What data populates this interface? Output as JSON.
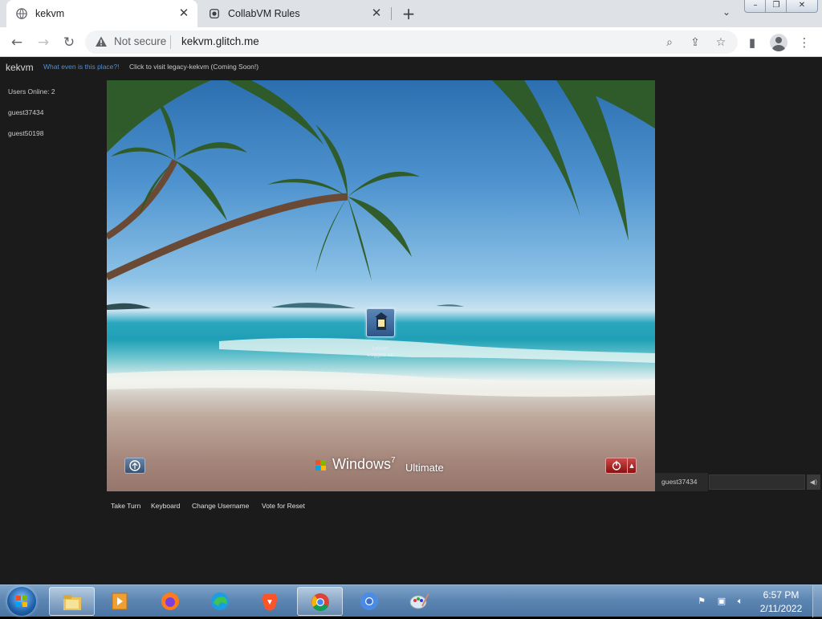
{
  "browser": {
    "tabs": [
      {
        "title": "kekvm",
        "active": true
      },
      {
        "title": "CollabVM Rules",
        "active": false
      }
    ],
    "security_label": "Not secure",
    "url": "kekvm.glitch.me"
  },
  "site": {
    "brand": "kekvm",
    "what_link": "What even is this place?!",
    "legacy_link": "Click to visit legacy-kekvm (Coming Soon!)",
    "users_online": "Users Online: 2",
    "users": [
      "guest37434",
      "guest50198"
    ]
  },
  "vm": {
    "logon_label_1": "kekvm",
    "logon_label_2": "Logged on",
    "windows_word": "Windows",
    "windows_version": "7",
    "windows_edition": "Ultimate"
  },
  "chat": {
    "username": "guest37434",
    "input_value": "",
    "send_icon": "speaker-icon"
  },
  "actions": {
    "take_turn": "Take Turn",
    "keyboard": "Keyboard",
    "change_username": "Change Username",
    "vote_reset": "Vote for Reset"
  },
  "taskbar": {
    "time": "6:57 PM",
    "date": "2/11/2022",
    "apps": [
      "file-explorer-icon",
      "media-player-icon",
      "firefox-icon",
      "edge-icon",
      "brave-icon",
      "chrome-icon",
      "chromium-icon",
      "paint-icon"
    ]
  },
  "colors": {
    "page_bg": "#1b1b1b",
    "link": "#4d8fd6",
    "omnibox_bg": "#f1f3f4"
  }
}
